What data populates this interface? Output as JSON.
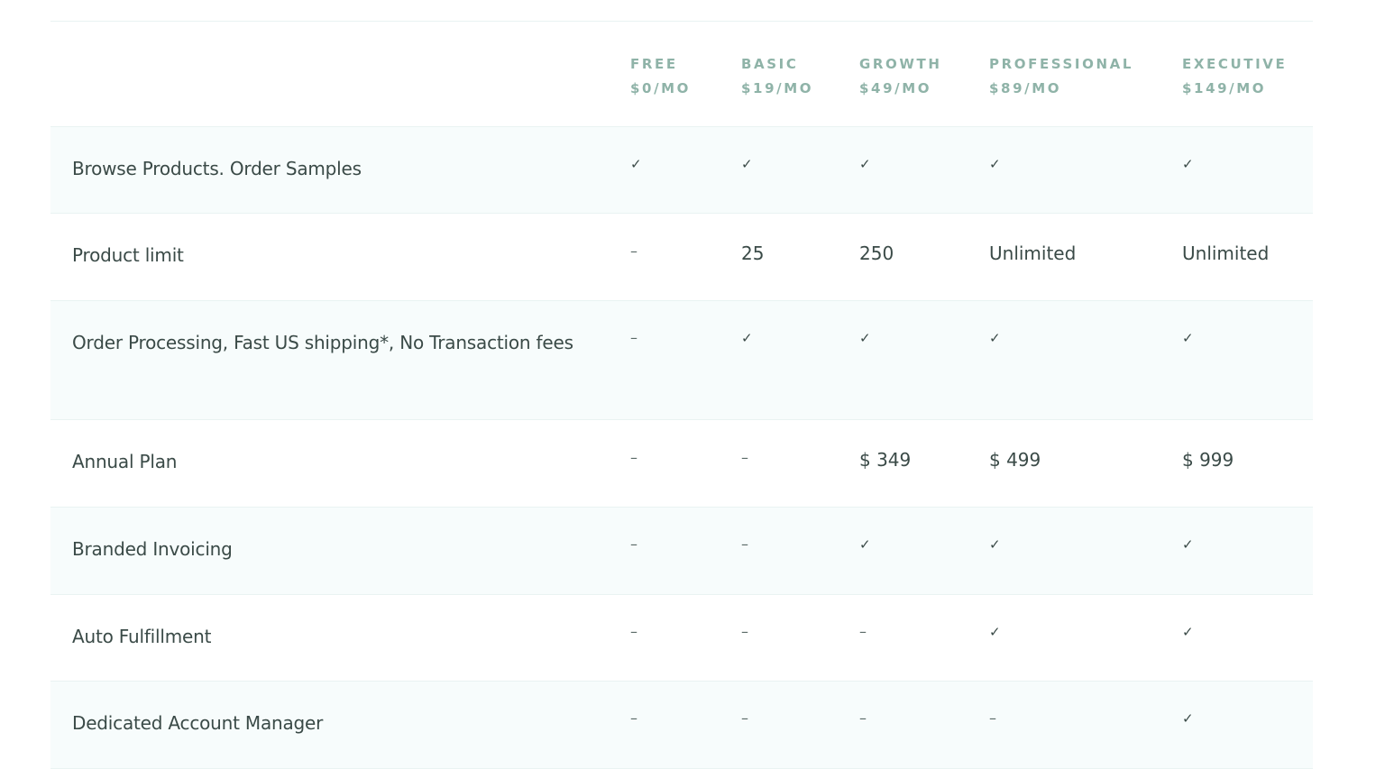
{
  "plans": [
    {
      "name": "FREE",
      "price": "$0/MO"
    },
    {
      "name": "BASIC",
      "price": "$19/MO"
    },
    {
      "name": "GROWTH",
      "price": "$49/MO"
    },
    {
      "name": "PROFESSIONAL",
      "price": "$89/MO"
    },
    {
      "name": "EXECUTIVE",
      "price": "$149/MO"
    }
  ],
  "rows": [
    {
      "feature": "Browse Products. Order Samples",
      "cells": [
        "✓",
        "✓",
        "✓",
        "✓",
        "✓"
      ]
    },
    {
      "feature": "Product limit",
      "cells": [
        "–",
        "25",
        "250",
        "Unlimited",
        "Unlimited"
      ]
    },
    {
      "feature": "Order Processing, Fast US shipping*, No Transaction fees",
      "cells": [
        "–",
        "✓",
        "✓",
        "✓",
        "✓"
      ]
    },
    {
      "feature": "Annual Plan",
      "cells": [
        "–",
        "–",
        "$ 349",
        "$ 499",
        "$ 999"
      ]
    },
    {
      "feature": "Branded Invoicing",
      "cells": [
        "–",
        "–",
        "✓",
        "✓",
        "✓"
      ]
    },
    {
      "feature": "Auto Fulfillment",
      "cells": [
        "–",
        "–",
        "–",
        "✓",
        "✓"
      ]
    },
    {
      "feature": "Dedicated Account Manager",
      "cells": [
        "–",
        "–",
        "–",
        "–",
        "✓"
      ]
    }
  ]
}
